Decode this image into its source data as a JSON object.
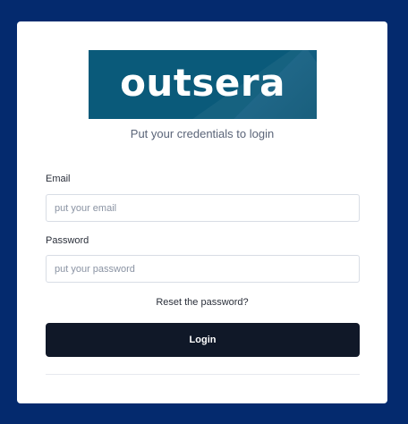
{
  "brand": {
    "logo_text": "outsera"
  },
  "login": {
    "subtitle": "Put your credentials to login",
    "email_label": "Email",
    "email_placeholder": "put your email",
    "email_value": "",
    "password_label": "Password",
    "password_placeholder": "put your password",
    "password_value": "",
    "reset_link": "Reset the password?",
    "login_button": "Login"
  },
  "colors": {
    "background": "#042a6e",
    "card": "#ffffff",
    "logo_bg": "#0a5a7a",
    "button_bg": "#101828"
  }
}
